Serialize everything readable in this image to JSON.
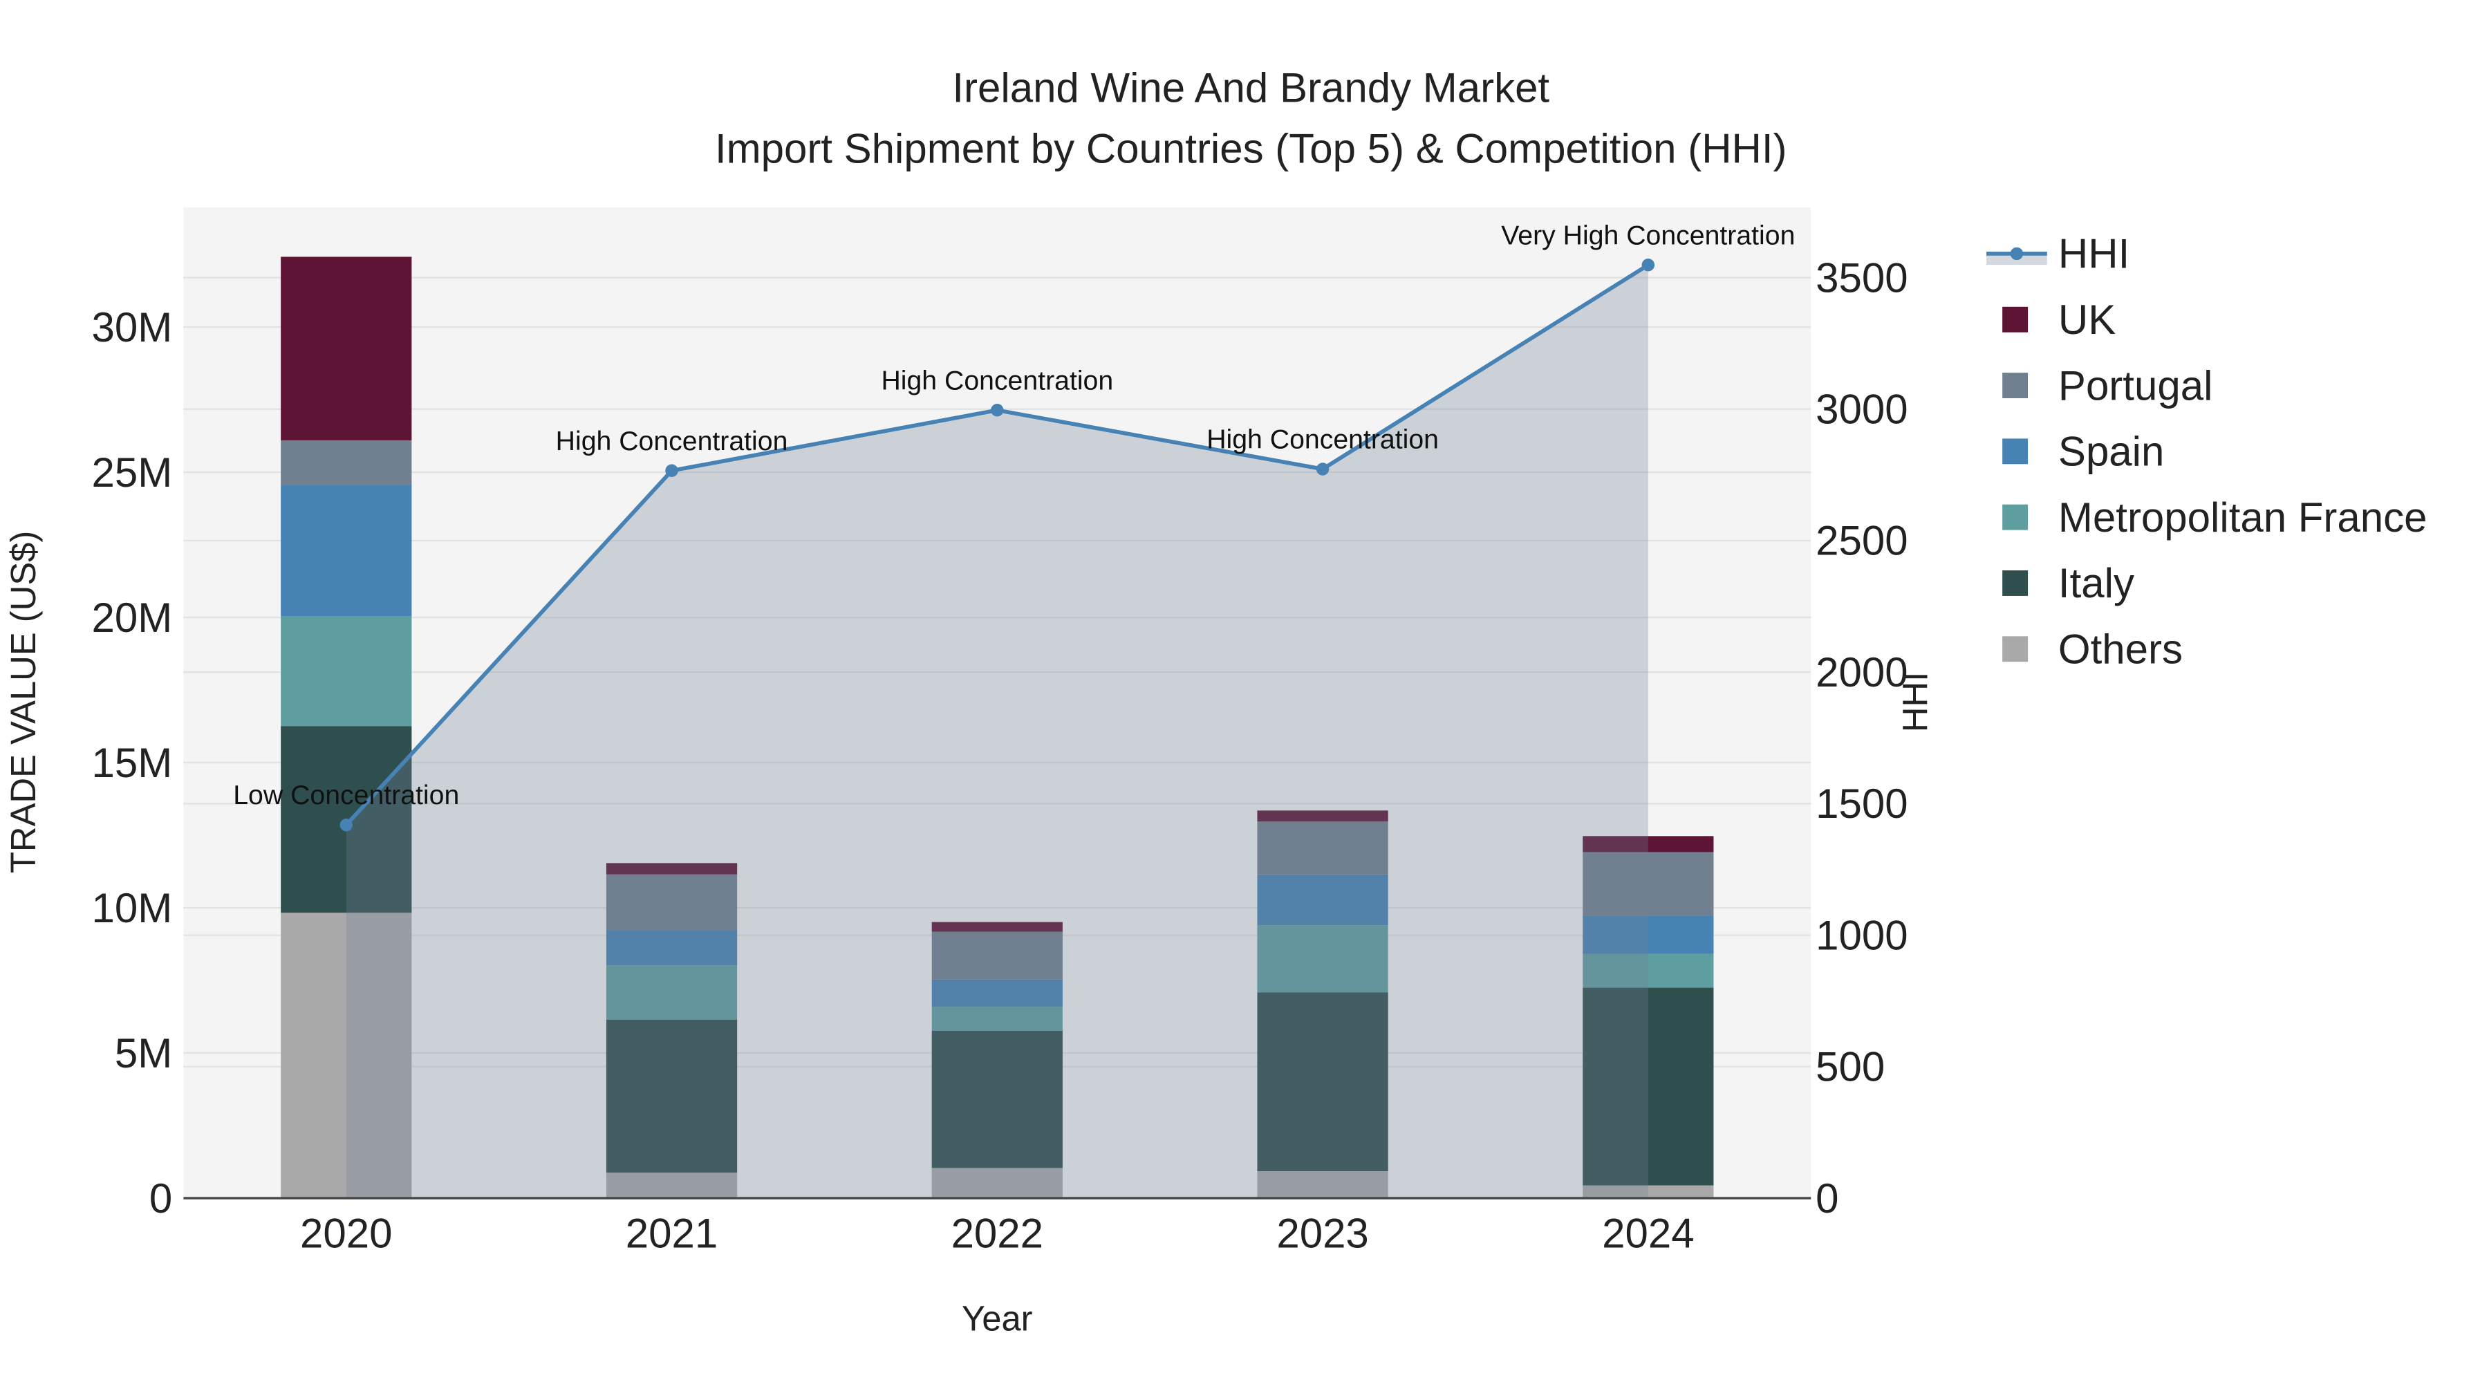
{
  "chart_data": {
    "type": "bar",
    "stacked": true,
    "title": "Ireland Wine And Brandy Market",
    "subtitle": "Import Shipment by Countries (Top 5) & Competition (HHI)",
    "xlabel": "Year",
    "ylabel": "TRADE VALUE (US$)",
    "y2label": "HHI",
    "categories": [
      "2020",
      "2021",
      "2022",
      "2023",
      "2024"
    ],
    "ylim": [
      0,
      34
    ],
    "y_ticks": [
      0,
      5,
      10,
      15,
      20,
      25,
      30
    ],
    "y_tick_labels": [
      "0",
      "5M",
      "10M",
      "15M",
      "20M",
      "25M",
      "30M"
    ],
    "y2lim": [
      0,
      3780
    ],
    "y2_ticks": [
      0,
      500,
      1000,
      1500,
      2000,
      2500,
      3000,
      3500
    ],
    "y2_tick_labels": [
      "0",
      "500",
      "1000",
      "1500",
      "2000",
      "2500",
      "3000",
      "3500"
    ],
    "units": "million US$",
    "series": [
      {
        "name": "Others",
        "color": "#a9a9a9",
        "values": [
          9.83,
          0.88,
          1.04,
          0.93,
          0.44
        ]
      },
      {
        "name": "Italy",
        "color": "#2f4f4f",
        "values": [
          6.43,
          5.27,
          4.73,
          6.16,
          6.81
        ]
      },
      {
        "name": "Metropolitan France",
        "color": "#5f9ea0",
        "values": [
          3.79,
          1.87,
          0.82,
          2.31,
          1.16
        ]
      },
      {
        "name": "Spain",
        "color": "#4682b4",
        "values": [
          4.51,
          1.21,
          0.94,
          1.75,
          1.32
        ]
      },
      {
        "name": "Portugal",
        "color": "#708090",
        "values": [
          1.54,
          1.92,
          1.65,
          1.82,
          2.19
        ]
      },
      {
        "name": "UK",
        "color": "#5e1434",
        "values": [
          6.32,
          0.39,
          0.33,
          0.38,
          0.55
        ]
      }
    ],
    "hhi": {
      "name": "HHI",
      "color": "#4682b4",
      "values": [
        1419,
        2766,
        2996,
        2772,
        3548
      ],
      "annotations": [
        "Low Concentration",
        "High Concentration",
        "High Concentration",
        "High Concentration",
        "Very High Concentration"
      ]
    },
    "legend_order": [
      "HHI",
      "UK",
      "Portugal",
      "Spain",
      "Metropolitan France",
      "Italy",
      "Others"
    ],
    "legend_position": "right",
    "grid": true
  }
}
